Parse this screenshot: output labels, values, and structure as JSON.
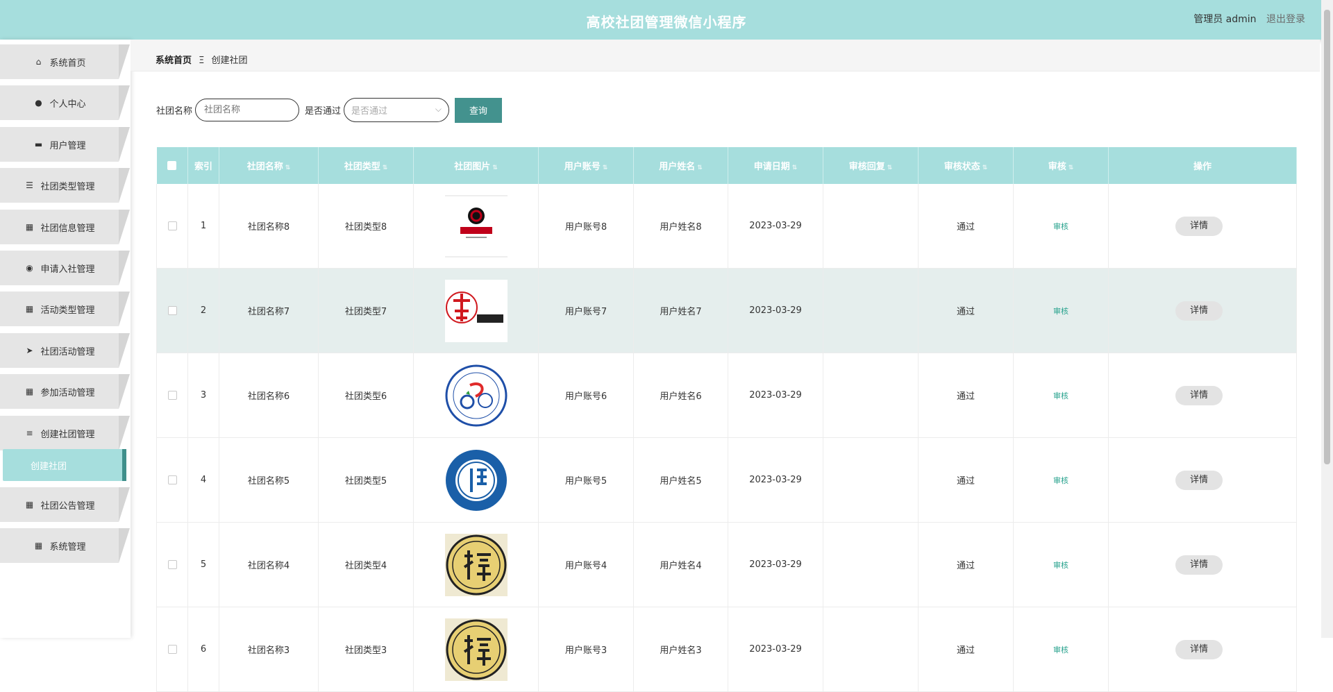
{
  "header": {
    "title": "高校社团管理微信小程序",
    "user_label": "管理员 admin",
    "logout_label": "退出登录"
  },
  "sidebar": {
    "items": [
      {
        "label": "系统首页",
        "icon": "home-icon"
      },
      {
        "label": "个人中心",
        "icon": "user-icon"
      },
      {
        "label": "用户管理",
        "icon": "chat-icon"
      },
      {
        "label": "社团类型管理",
        "icon": "sliders-icon"
      },
      {
        "label": "社团信息管理",
        "icon": "grid-icon"
      },
      {
        "label": "申请入社管理",
        "icon": "location-pin-icon"
      },
      {
        "label": "活动类型管理",
        "icon": "grid-icon"
      },
      {
        "label": "社团活动管理",
        "icon": "paper-plane-icon"
      },
      {
        "label": "参加活动管理",
        "icon": "grid-icon"
      },
      {
        "label": "创建社团管理",
        "icon": "list-icon"
      },
      {
        "label": "社团公告管理",
        "icon": "grid-icon"
      },
      {
        "label": "系统管理",
        "icon": "grid-icon"
      }
    ],
    "active_sub": "创建社团"
  },
  "breadcrumb": {
    "home": "系统首页",
    "separator": "Ξ",
    "current": "创建社团"
  },
  "search": {
    "name_label": "社团名称",
    "name_placeholder": "社团名称",
    "pass_label": "是否通过",
    "pass_placeholder": "是否通过",
    "query_button": "查询"
  },
  "table": {
    "columns": [
      "索引",
      "社团名称",
      "社团类型",
      "社团图片",
      "用户账号",
      "用户姓名",
      "申请日期",
      "审核回复",
      "审核状态",
      "审核",
      "操作"
    ],
    "rows": [
      {
        "index": "1",
        "name": "社团名称8",
        "type": "社团类型8",
        "account": "用户账号8",
        "username": "用户姓名8",
        "date": "2023-03-29",
        "reply": "",
        "status": "通过",
        "audit": "审核",
        "action": "详情",
        "image": "drama-society-logo"
      },
      {
        "index": "2",
        "name": "社团名称7",
        "type": "社团类型7",
        "account": "用户账号7",
        "username": "用户姓名7",
        "date": "2023-03-29",
        "reply": "",
        "status": "通过",
        "audit": "审核",
        "action": "详情",
        "image": "poetry-society-logo"
      },
      {
        "index": "3",
        "name": "社团名称6",
        "type": "社团类型6",
        "account": "用户账号6",
        "username": "用户姓名6",
        "date": "2023-03-29",
        "reply": "",
        "status": "通过",
        "audit": "审核",
        "action": "详情",
        "image": "cycling-club-logo"
      },
      {
        "index": "4",
        "name": "社团名称5",
        "type": "社团类型5",
        "account": "用户账号5",
        "username": "用户姓名5",
        "date": "2023-03-29",
        "reply": "",
        "status": "通过",
        "audit": "审核",
        "action": "详情",
        "image": "music-association-logo"
      },
      {
        "index": "5",
        "name": "社团名称4",
        "type": "社团类型4",
        "account": "用户账号4",
        "username": "用户姓名4",
        "date": "2023-03-29",
        "reply": "",
        "status": "通过",
        "audit": "审核",
        "action": "详情",
        "image": "chess-club-logo"
      },
      {
        "index": "6",
        "name": "社团名称3",
        "type": "社团类型3",
        "account": "用户账号3",
        "username": "用户姓名3",
        "date": "2023-03-29",
        "reply": "",
        "status": "通过",
        "audit": "审核",
        "action": "详情",
        "image": "chess-club-logo"
      }
    ]
  },
  "colors": {
    "accent": "#a6dedd",
    "button": "#43928e",
    "audit_link": "#27a28d",
    "row_highlight": "#e5eeed"
  }
}
